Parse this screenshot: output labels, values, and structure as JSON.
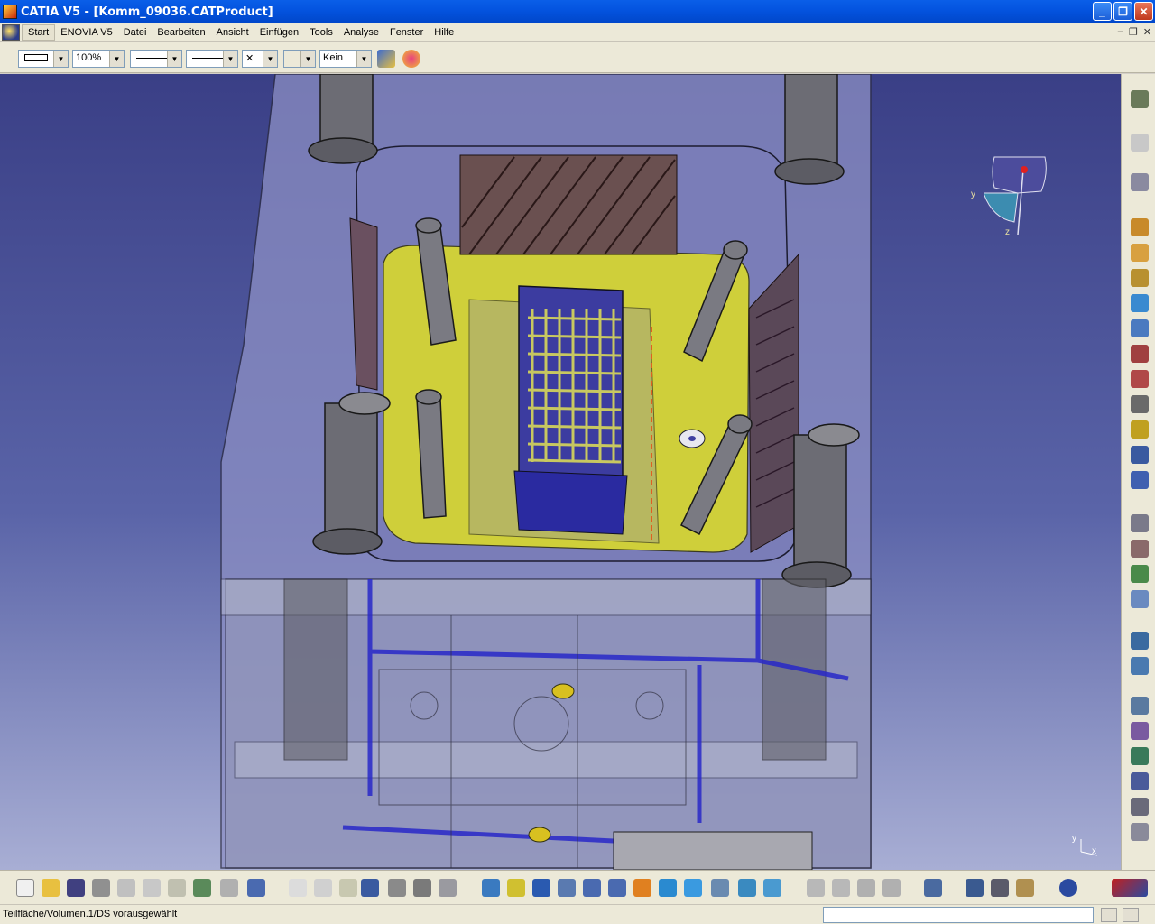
{
  "window": {
    "title": "CATIA V5 - [Komm_09036.CATProduct]",
    "min": "_",
    "max": "❐",
    "close": "✕"
  },
  "menu": {
    "items": [
      "Start",
      "ENOVIA V5",
      "Datei",
      "Bearbeiten",
      "Ansicht",
      "Einfügen",
      "Tools",
      "Analyse",
      "Fenster",
      "Hilfe"
    ],
    "mdi_min": "–",
    "mdi_restore": "❐",
    "mdi_close": "✕"
  },
  "format_toolbar": {
    "zoom": "100%",
    "linetype_symbol": "✕",
    "layer": "Kein"
  },
  "compass": {
    "y_label": "y",
    "z_label": "z"
  },
  "axis_mini": {
    "y_label": "y",
    "x_label": "x"
  },
  "status": {
    "message": "Teilfläche/Volumen.1/DS vorausgewählt"
  },
  "icons": {
    "right_toolbar": [
      "gear-icon",
      "select-arrow-icon",
      "fly-mode-icon",
      "assembly-component-icon",
      "new-product-icon",
      "new-part-icon",
      "existing-component-icon",
      "replace-component-icon",
      "graph-tree-icon",
      "generate-numbering-icon",
      "bill-of-material-icon",
      "publication-icon",
      "manipulate-icon",
      "snap-icon",
      "explode-icon",
      "stop-manipulate-icon",
      "reorder-icon",
      "multi-instantiate-icon",
      "constraint-coincidence-icon",
      "constraint-contact-icon",
      "constraint-offset-icon",
      "constraint-angle-icon",
      "fix-component-icon",
      "fix-together-icon",
      "quick-constraint-icon",
      "flexible-rigid-icon"
    ],
    "bottom_toolbar": [
      "new-icon",
      "open-icon",
      "save-icon",
      "print-icon",
      "cut-icon",
      "copy-icon",
      "paste-icon",
      "undo-icon",
      "redo-icon",
      "whats-this-icon",
      "formula-icon",
      "comment-icon",
      "light-icon",
      "table-icon",
      "measure-icon",
      "lock-icon",
      "catalog-icon",
      "fly-icon",
      "fit-all-icon",
      "pan-icon",
      "rotate-icon",
      "zoom-in-icon",
      "zoom-out-icon",
      "normal-view-icon",
      "multi-view-icon",
      "iso-view-icon",
      "shading-icon",
      "hide-show-icon",
      "swap-space-icon",
      "update-icon",
      "clash-icon",
      "sectioning-icon",
      "distance-icon",
      "catia-logo-icon"
    ]
  }
}
